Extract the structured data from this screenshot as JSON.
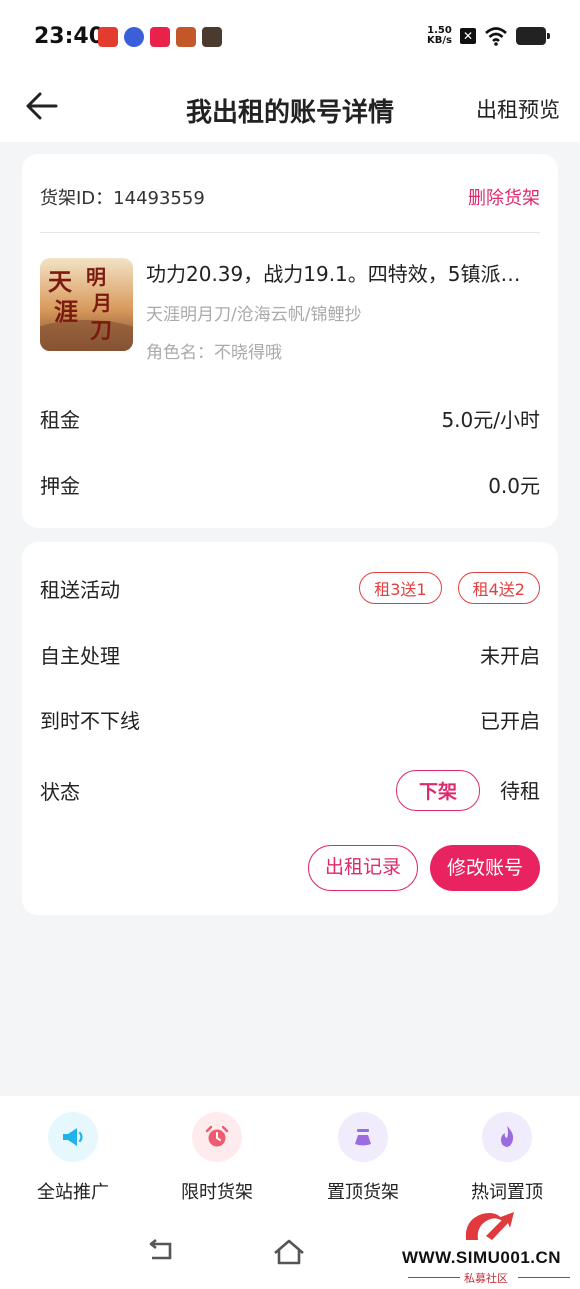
{
  "status_bar": {
    "time": "23:40",
    "net_speed_value": "1.50",
    "net_speed_unit": "KB/s"
  },
  "nav": {
    "title": "我出租的账号详情",
    "action": "出租预览"
  },
  "listing": {
    "id_label": "货架ID：14493559",
    "delete_label": "删除货架",
    "game_title": "功力20.39，战力19.1。四特效，5镇派…",
    "servers": "天涯明月刀/沧海云帆/锦鲤抄",
    "role_name": "角色名：不晓得哦",
    "thumb_text": "天涯明月刀"
  },
  "pricing": {
    "rent_label": "租金",
    "rent_value": "5.0元/小时",
    "deposit_label": "押金",
    "deposit_value": "0.0元"
  },
  "settings": {
    "promo_label": "租送活动",
    "promo_tags": [
      "租3送1",
      "租4送2"
    ],
    "self_handle_label": "自主处理",
    "self_handle_value": "未开启",
    "no_offline_label": "到时不下线",
    "no_offline_value": "已开启",
    "status_label": "状态",
    "status_button": "下架",
    "status_value": "待租",
    "record_button": "出租记录",
    "edit_button": "修改账号"
  },
  "tools": [
    {
      "label": "全站推广",
      "icon": "megaphone-icon",
      "bg": "#e6f7fd",
      "color": "#1fb3e8"
    },
    {
      "label": "限时货架",
      "icon": "alarm-clock-icon",
      "bg": "#fdebee",
      "color": "#f05a6e"
    },
    {
      "label": "置顶货架",
      "icon": "pin-top-icon",
      "bg": "#f1ecfb",
      "color": "#9b6be0"
    },
    {
      "label": "热词置顶",
      "icon": "flame-icon",
      "bg": "#f1ecfb",
      "color": "#9b6be0"
    }
  ],
  "watermark": {
    "url": "WWW.SIMU001.CN",
    "sub": "私募社区"
  },
  "colors": {
    "accent": "#e8235f",
    "tag_red": "#e04040",
    "muted": "#aaaaaa"
  }
}
